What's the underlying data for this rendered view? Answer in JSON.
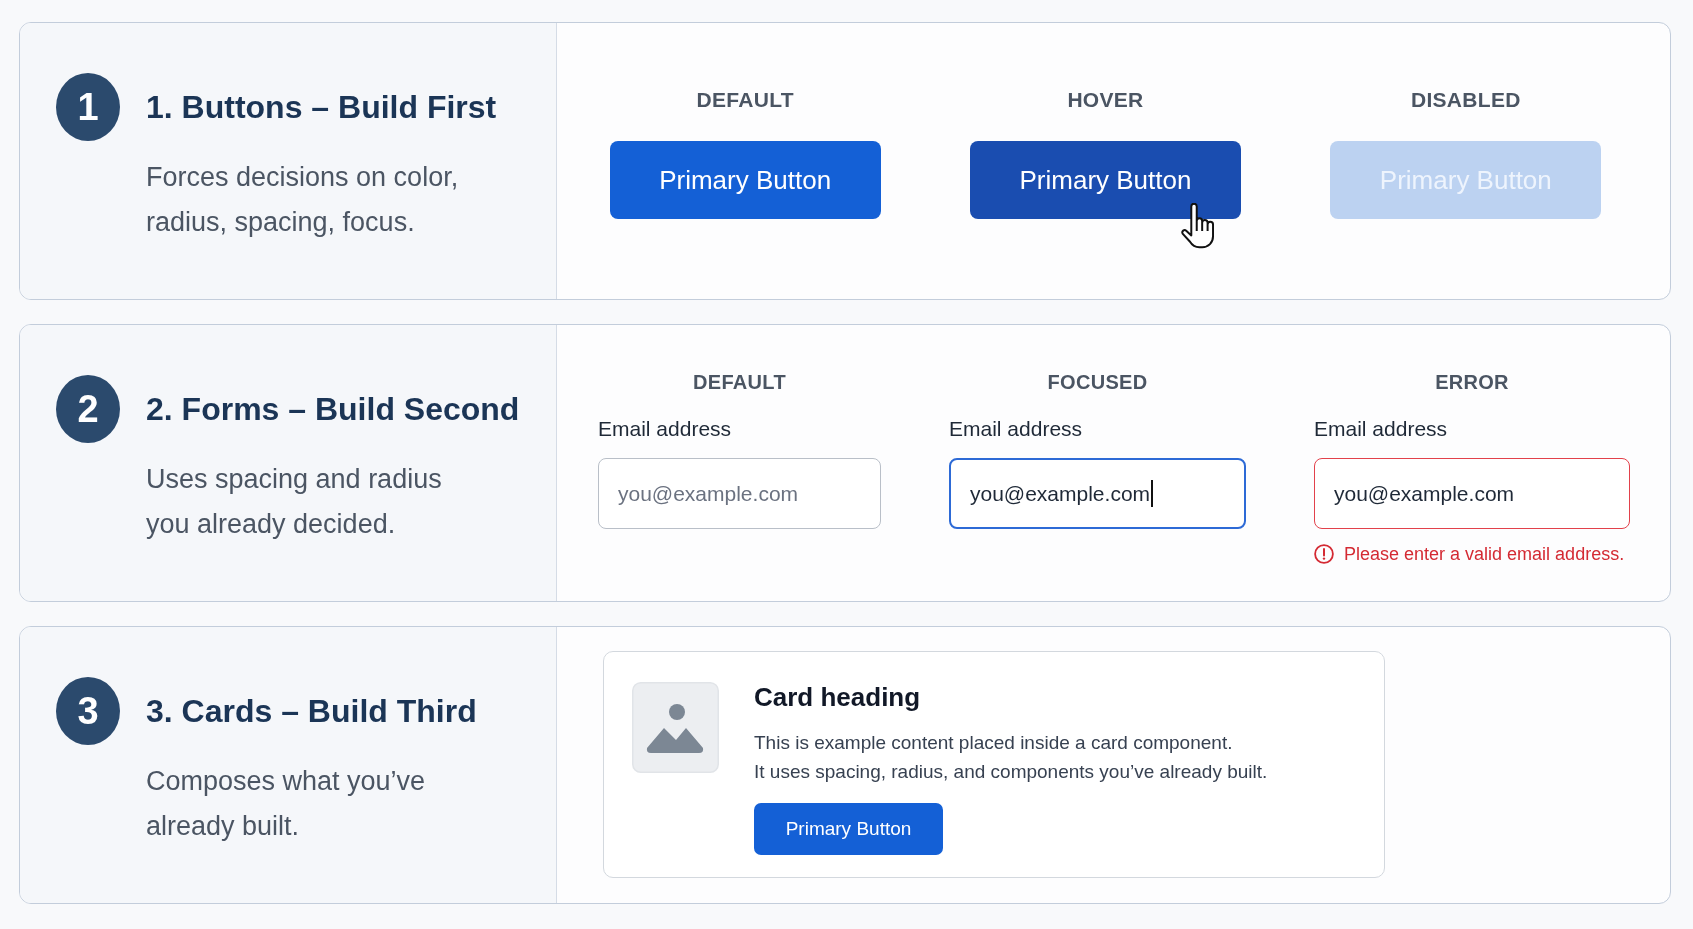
{
  "sections": [
    {
      "kind": "buttons",
      "number": "1",
      "title": "1. Buttons – Build First",
      "description": "Forces decisions on color, radius, spacing, focus.",
      "demos": [
        {
          "heading": "DEFAULT",
          "label": "Primary Button",
          "hovered": false,
          "disabled": false
        },
        {
          "heading": "HOVER",
          "label": "Primary Button",
          "hovered": true,
          "disabled": false
        },
        {
          "heading": "DISABLED",
          "label": "Primary Button",
          "hovered": false,
          "disabled": true
        }
      ]
    },
    {
      "kind": "forms",
      "number": "2",
      "title": "2. Forms – Build Second",
      "description": "Uses spacing and radius you already decided.",
      "demos": [
        {
          "heading": "DEFAULT",
          "label": "Email address",
          "placeholder": "you@example.com",
          "focused": false,
          "invalid": false
        },
        {
          "heading": "FOCUSED",
          "label": "Email address",
          "value": "you@example.com",
          "focused": true,
          "invalid": false
        },
        {
          "heading": "ERROR",
          "label": "Email address",
          "value": "you@example.com",
          "focused": false,
          "invalid": true,
          "error": "Please enter a valid email address."
        }
      ]
    },
    {
      "kind": "card",
      "number": "3",
      "title": "3. Cards – Build Third",
      "description": "Composes what you’ve already built.",
      "card": {
        "heading": "Card heading",
        "body": [
          "This is example content placed inside a card component.",
          "It uses spacing, radius, and components you’ve already built."
        ],
        "button": "Primary Button"
      }
    }
  ]
}
